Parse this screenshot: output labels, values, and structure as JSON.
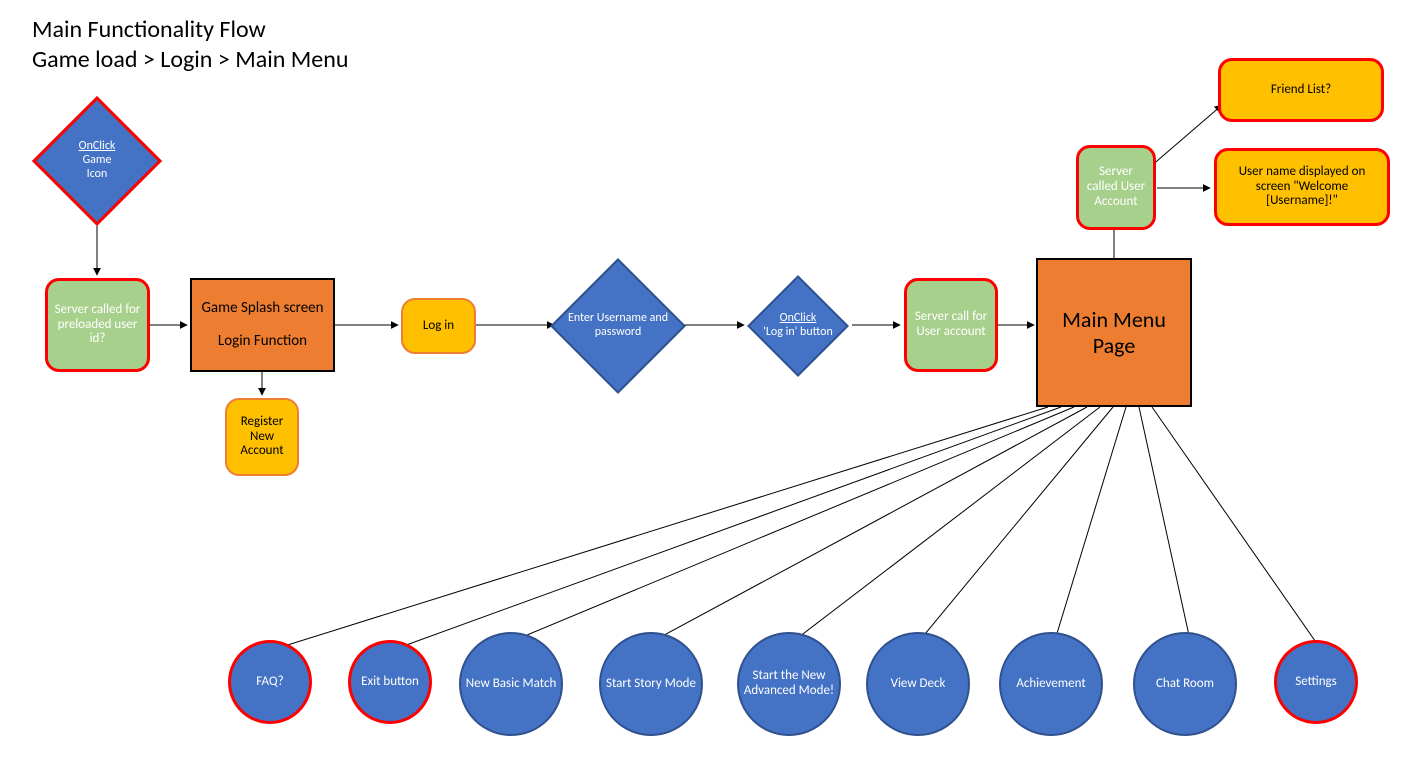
{
  "title": {
    "line1": "Main Functionality Flow",
    "line2": "Game load > Login > Main Menu"
  },
  "nodes": {
    "onclick_game_icon": {
      "line1": "OnClick",
      "line2": "Game",
      "line3": "Icon"
    },
    "server_preloaded": "Server called for preloaded user id?",
    "game_splash": {
      "line1": "Game Splash screen",
      "line2": "Login Function"
    },
    "register_new": "Register New Account",
    "log_in": "Log in",
    "enter_creds": "Enter Username and password",
    "onclick_login": {
      "line1": "OnClick",
      "line2": "'Log in' button"
    },
    "server_call_user": "Server call for User account",
    "main_menu_page": "Main Menu Page",
    "server_called_user_account": "Server called User Account",
    "friend_list": "Friend List?",
    "welcome_msg": "User name displayed on screen \"Welcome [Username]!\"",
    "faq": "FAQ?",
    "exit_button": "Exit button",
    "new_basic_match": "New Basic Match",
    "start_story_mode": "Start Story Mode",
    "start_new_advanced": "Start the New Advanced Mode!",
    "view_deck": "View Deck",
    "achievement": "Achievement",
    "chat_room": "Chat Room",
    "settings": "Settings"
  }
}
